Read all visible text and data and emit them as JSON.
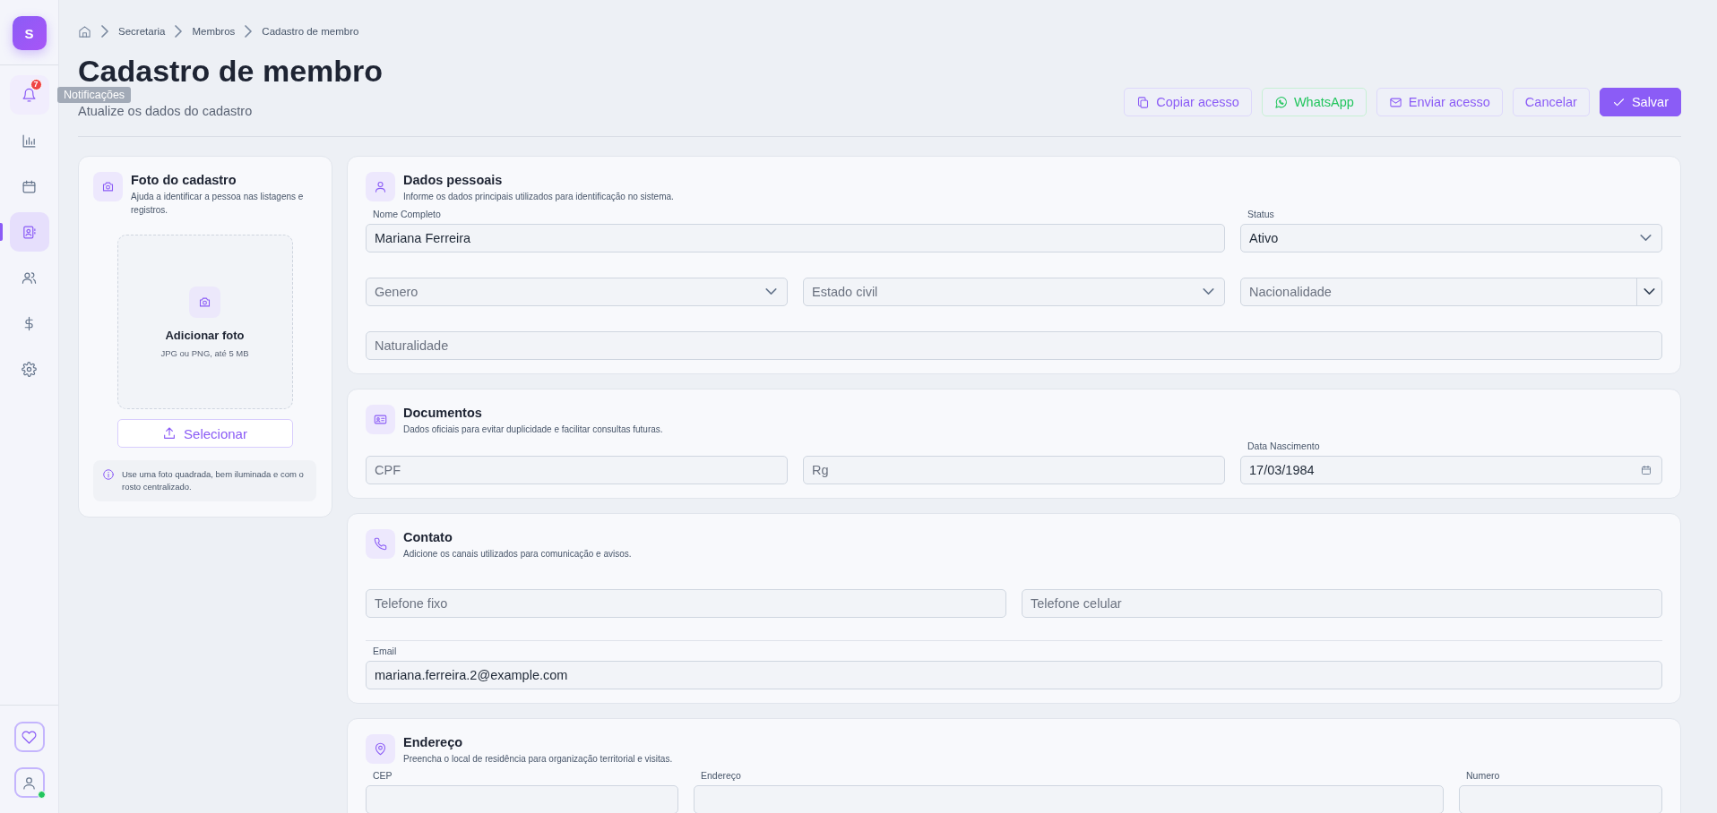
{
  "sidebar": {
    "logo": "S",
    "items": [
      {
        "selected": false,
        "hover": true,
        "badge": "7",
        "tooltip": "Notificações"
      },
      {
        "selected": false,
        "hover": false
      },
      {
        "selected": false,
        "hover": false
      },
      {
        "selected": true,
        "hover": false
      },
      {
        "selected": false,
        "hover": false
      },
      {
        "selected": false,
        "hover": false
      },
      {
        "selected": false,
        "hover": false
      }
    ],
    "bottom": [
      {
        "online": false
      },
      {
        "online": true
      }
    ]
  },
  "breadcrumb": [
    "Secretaria",
    "Membros",
    "Cadastro de membro"
  ],
  "header": {
    "title": "Cadastro de membro",
    "subtitle": "Atualize os dados do cadastro"
  },
  "actions": [
    {
      "label": "Copiar acesso",
      "kind": "outline"
    },
    {
      "label": "WhatsApp",
      "kind": "whatsapp"
    },
    {
      "label": "Enviar acesso",
      "kind": "outline"
    },
    {
      "label": "Cancelar",
      "kind": "plain"
    },
    {
      "label": "Salvar",
      "kind": "primary"
    }
  ],
  "photo_card": {
    "title": "Foto do cadastro",
    "description": "Ajuda a identificar a pessoa nas listagens e registros.",
    "drop_title": "Adicionar foto",
    "drop_hint": "JPG ou PNG, até 5 MB",
    "button": "Selecionar",
    "tip": "Use uma foto quadrada, bem iluminada e com o rosto centralizado."
  },
  "sections": [
    {
      "title": "Dados pessoais",
      "description": "Informe os dados principais utilizados para identificação no sistema.",
      "rows": [
        {
          "divider": false,
          "fields": [
            {
              "label": "Nome Completo",
              "value": "Mariana Ferreira",
              "kind": "text"
            },
            {
              "label": "Status",
              "value": "Ativo",
              "kind": "select"
            }
          ]
        },
        {
          "divider": false,
          "fields": [
            {
              "placeholder": "Genero",
              "kind": "select"
            },
            {
              "placeholder": "Estado civil",
              "kind": "select"
            },
            {
              "placeholder": "Nacionalidade",
              "kind": "combo"
            }
          ]
        },
        {
          "divider": false,
          "fields": [
            {
              "placeholder": "Naturalidade",
              "kind": "text"
            }
          ]
        }
      ]
    },
    {
      "title": "Documentos",
      "description": "Dados oficiais para evitar duplicidade e facilitar consultas futuras.",
      "rows": [
        {
          "divider": false,
          "fields": [
            {
              "placeholder": "CPF",
              "kind": "text"
            },
            {
              "placeholder": "Rg",
              "kind": "text"
            },
            {
              "label": "Data Nascimento",
              "value": "17/03/1984",
              "kind": "date"
            }
          ]
        }
      ]
    },
    {
      "title": "Contato",
      "description": "Adicione os canais utilizados para comunicação e avisos.",
      "rows": [
        {
          "divider": false,
          "fields": [
            {
              "placeholder": "Telefone fixo",
              "kind": "text"
            },
            {
              "placeholder": "Telefone celular",
              "kind": "text"
            }
          ]
        },
        {
          "divider": true,
          "fields": [
            {
              "label": "Email",
              "value": "mariana.ferreira.2@example.com",
              "kind": "text"
            }
          ]
        }
      ]
    },
    {
      "title": "Endereço",
      "description": "Preencha o local de residência para organização territorial e visitas.",
      "rows": [
        {
          "divider": false,
          "fields": [
            {
              "label": "CEP",
              "kind": "text"
            },
            {
              "label": "Endereço",
              "kind": "text"
            },
            {
              "label": "Numero",
              "kind": "text"
            }
          ]
        }
      ]
    }
  ]
}
